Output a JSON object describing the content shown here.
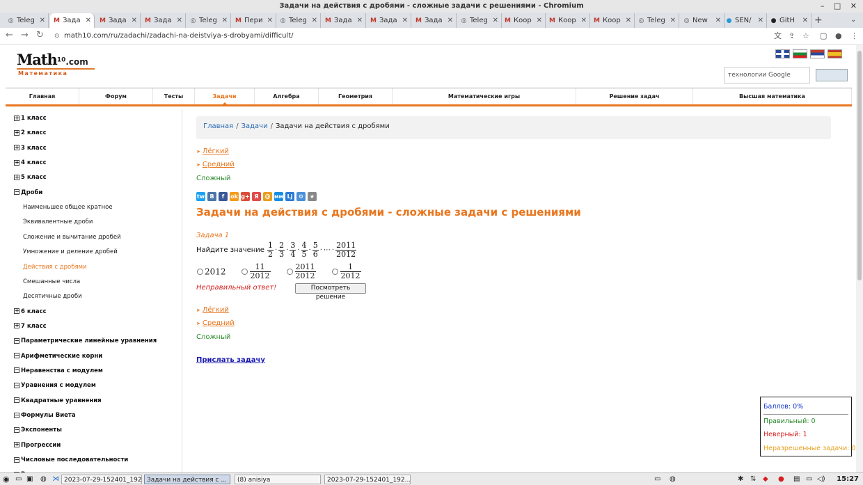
{
  "window": {
    "title": "Задачи на действия с дробями - сложные задачи с решениями - Chromium",
    "controls": "–  □  ✕"
  },
  "tabs": [
    {
      "icon": "◎",
      "label": "Teleg",
      "color": "#555"
    },
    {
      "icon": "M",
      "label": "Зада",
      "color": "#c0392b",
      "active": true
    },
    {
      "icon": "M",
      "label": "Зада",
      "color": "#c0392b"
    },
    {
      "icon": "M",
      "label": "Зада",
      "color": "#c0392b"
    },
    {
      "icon": "◎",
      "label": "Teleg",
      "color": "#555"
    },
    {
      "icon": "M",
      "label": "Пери",
      "color": "#c0392b"
    },
    {
      "icon": "◎",
      "label": "Teleg",
      "color": "#555"
    },
    {
      "icon": "M",
      "label": "Зада",
      "color": "#c0392b"
    },
    {
      "icon": "M",
      "label": "Зада",
      "color": "#c0392b"
    },
    {
      "icon": "M",
      "label": "Зада",
      "color": "#c0392b"
    },
    {
      "icon": "◎",
      "label": "Teleg",
      "color": "#555"
    },
    {
      "icon": "M",
      "label": "Коор",
      "color": "#c0392b"
    },
    {
      "icon": "M",
      "label": "Коор",
      "color": "#c0392b"
    },
    {
      "icon": "M",
      "label": "Коор",
      "color": "#c0392b"
    },
    {
      "icon": "◎",
      "label": "Teleg",
      "color": "#555"
    },
    {
      "icon": "◎",
      "label": "New",
      "color": "#555"
    },
    {
      "icon": "●",
      "label": "SEN/",
      "color": "#2a9ad8"
    },
    {
      "icon": "●",
      "label": "GitH",
      "color": "#222"
    }
  ],
  "newtab_glyph": "+",
  "tabmenu_glyph": "⌄",
  "address": {
    "url": "math10.com/ru/zadachi/zadachi-na-deistviya-s-drobyami/difficult/",
    "lock": "🔒"
  },
  "nav_glyphs": {
    "back": "←",
    "forward": "→",
    "reload": "↻"
  },
  "site": {
    "logo_main": "Math",
    "logo_sup": "10",
    "logo_com": ".com",
    "logo_sub": "Математика",
    "search_placeholder": "технологии Google",
    "search_button": ""
  },
  "menu": [
    "Главная",
    "Форум",
    "Тесты",
    "Задачи",
    "Алгебра",
    "Геометрия",
    "Математические игры",
    "Решение задач",
    "Высшая математика"
  ],
  "menu_selected": 3,
  "sidebar": [
    {
      "label": "1 класс",
      "sign": "+",
      "type": "cat"
    },
    {
      "label": "2 класс",
      "sign": "+",
      "type": "cat"
    },
    {
      "label": "3 класс",
      "sign": "+",
      "type": "cat"
    },
    {
      "label": "4 класс",
      "sign": "+",
      "type": "cat"
    },
    {
      "label": "5 класс",
      "sign": "+",
      "type": "cat"
    },
    {
      "label": "Дроби",
      "sign": "−",
      "type": "cat"
    },
    {
      "label": "Наименьшее общее кратное",
      "type": "sub"
    },
    {
      "label": "Эквивалентные дроби",
      "type": "sub"
    },
    {
      "label": "Сложение и вычитание дробей",
      "type": "sub"
    },
    {
      "label": "Умножение и деление дробей",
      "type": "sub"
    },
    {
      "label": "Действия с дробями",
      "type": "sub",
      "current": true
    },
    {
      "label": "Смешанные числа",
      "type": "sub"
    },
    {
      "label": "Десятичные дроби",
      "type": "sub"
    },
    {
      "label": "6 класс",
      "sign": "+",
      "type": "cat"
    },
    {
      "label": "7 класс",
      "sign": "+",
      "type": "cat"
    },
    {
      "label": "Параметрические линейные уравнения",
      "sign": "−",
      "type": "cat"
    },
    {
      "label": "Арифметические корни",
      "sign": "−",
      "type": "cat"
    },
    {
      "label": "Неравенства с модулем",
      "sign": "−",
      "type": "cat"
    },
    {
      "label": "Уравнения с модулем",
      "sign": "−",
      "type": "cat"
    },
    {
      "label": "Квадратные уравнения",
      "sign": "−",
      "type": "cat"
    },
    {
      "label": "Формулы Виета",
      "sign": "−",
      "type": "cat"
    },
    {
      "label": "Экспоненты",
      "sign": "−",
      "type": "cat"
    },
    {
      "label": "Прогрессии",
      "sign": "+",
      "type": "cat"
    },
    {
      "label": "Числовые последовательности",
      "sign": "−",
      "type": "cat"
    },
    {
      "label": "Возвратные уравнения",
      "sign": "−",
      "type": "cat"
    }
  ],
  "breadcrumb": {
    "home": "Главная",
    "section": "Задачи",
    "current": "Задачи на действия с дробями",
    "sep": "/"
  },
  "levels": {
    "easy": "Лёгкий",
    "medium": "Средний",
    "hard": "Сложный"
  },
  "social_icons": [
    "tw",
    "B",
    "f",
    "ok",
    "g+",
    "Я",
    "@",
    "мм",
    "Lj",
    "⚙",
    "★"
  ],
  "heading": "Задачи на действия с дробями - сложные задачи с решениями",
  "task": {
    "label": "Задача 1",
    "prompt": "Найдите значение",
    "fractions": [
      [
        "1",
        "2"
      ],
      [
        "2",
        "3"
      ],
      [
        "3",
        "4"
      ],
      [
        "4",
        "5"
      ],
      [
        "5",
        "6"
      ]
    ],
    "ellipsis": "⋯",
    "last_fraction": [
      "2011",
      "2012"
    ],
    "answers": [
      {
        "kind": "int",
        "value": "2012"
      },
      {
        "kind": "frac",
        "n": "11",
        "d": "2012"
      },
      {
        "kind": "frac",
        "n": "2011",
        "d": "2012"
      },
      {
        "kind": "frac",
        "n": "1",
        "d": "2012"
      }
    ],
    "feedback": "Неправильный ответ!",
    "show_solution": "Посмотреть решение"
  },
  "send_task": "Прислать задачу",
  "score": {
    "points": "Баллов: 0%",
    "correct": "Правильный: 0",
    "wrong": "Неверный: 1",
    "unresolved": "Неразрешенные задачи: 0"
  },
  "taskbar": {
    "items": [
      {
        "label": "2023-07-29-152401_192...",
        "kind": "app"
      },
      {
        "label": "Задачи на действия с ...",
        "kind": "app",
        "active": true
      },
      {
        "label": "(8) anisiya",
        "kind": "app"
      },
      {
        "label": "2023-07-29-152401_192...",
        "kind": "app"
      }
    ],
    "clock": "15:27"
  }
}
